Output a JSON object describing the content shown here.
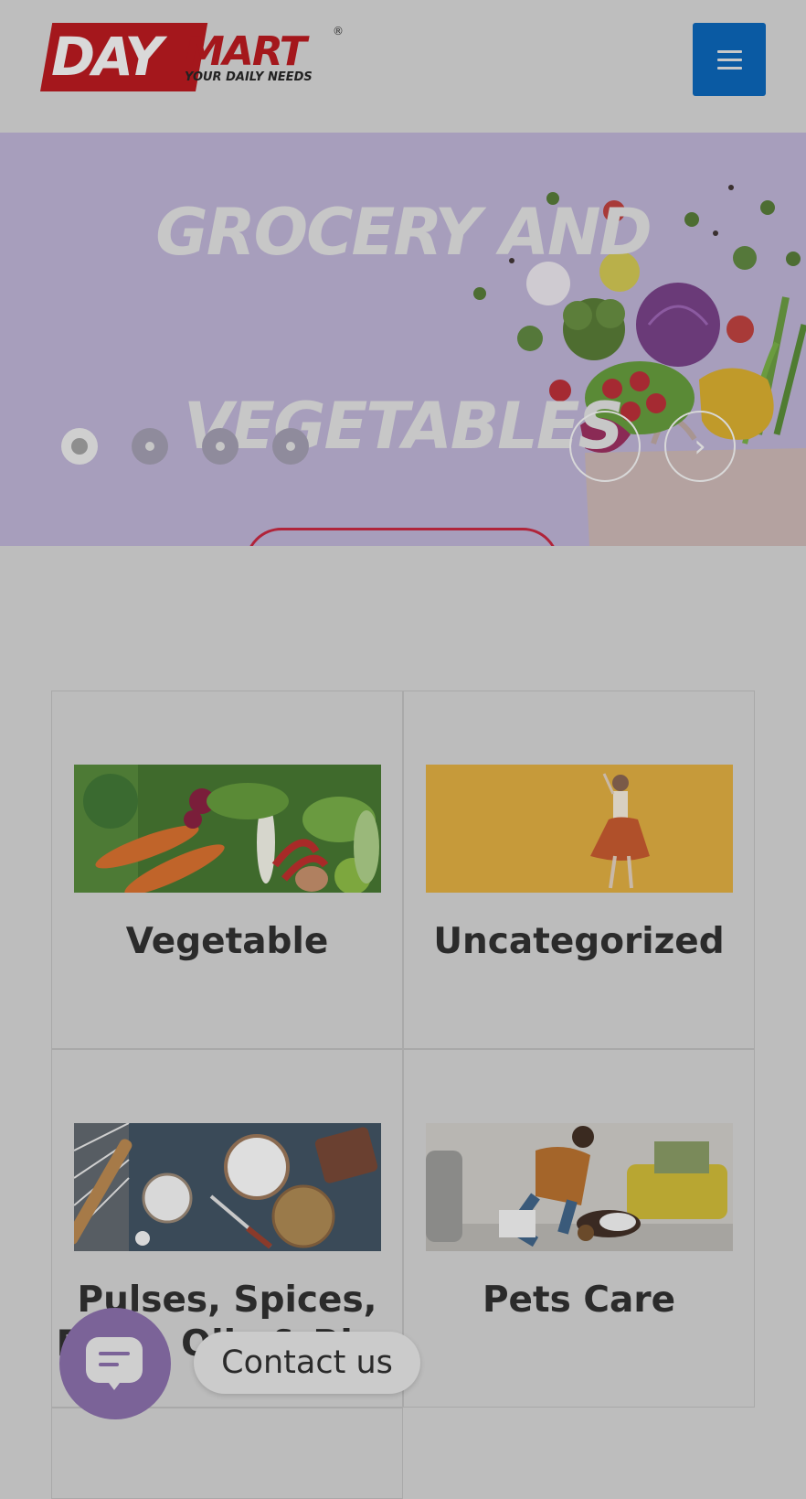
{
  "header": {
    "logo": {
      "brand_day": "DAY",
      "brand_mart": "MART",
      "tagline": "YOUR DAILY NEEDS",
      "registered": "®"
    },
    "menu_icon": "hamburger-menu-icon",
    "menu_color": "#0a5aa3"
  },
  "hero": {
    "title_line1": "GROCERY AND",
    "title_line2": "VEGETABLES",
    "background": "#a79ebc",
    "slides": 4,
    "active_slide": 1,
    "next_icon": "chevron-right-icon",
    "cta_border_color": "#b0243a"
  },
  "categories": [
    {
      "title": "Vegetable",
      "image": "vegetables-photo"
    },
    {
      "title": "Uncategorized",
      "image": "woman-dancing-photo"
    },
    {
      "title": "Pulses, Spices, Flour, Oils & Rice",
      "image": "flour-and-bread-photo"
    },
    {
      "title": "Pets Care",
      "image": "man-feeding-dog-photo"
    }
  ],
  "contact": {
    "label": "Contact us",
    "icon": "chat-bubble-icon",
    "color": "#7b6398"
  }
}
